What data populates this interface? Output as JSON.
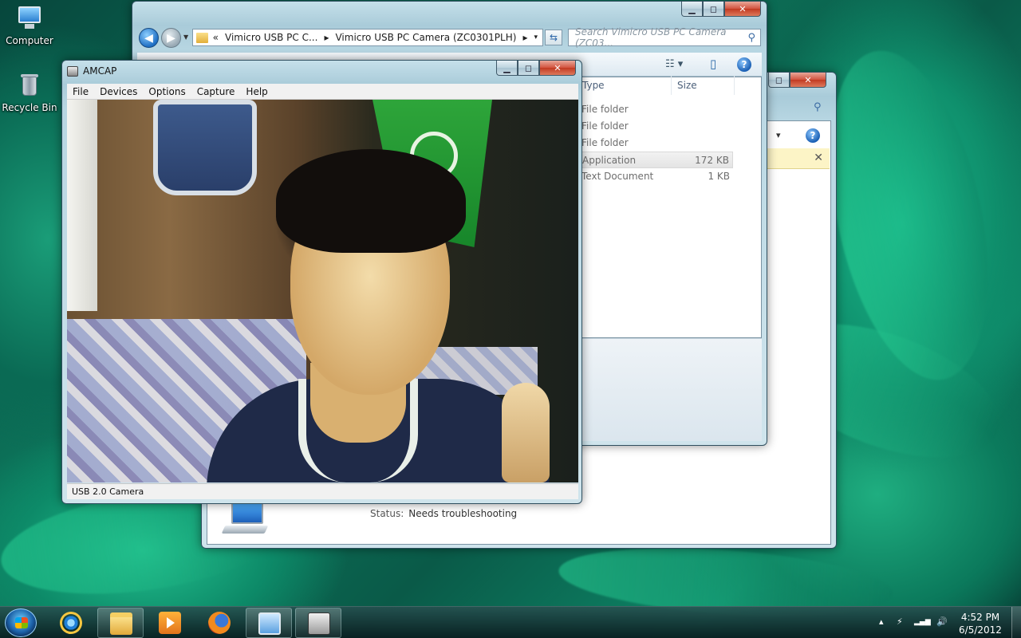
{
  "desktop": {
    "icons": [
      {
        "label": "Computer"
      },
      {
        "label": "Recycle Bin"
      }
    ]
  },
  "explorer_front": {
    "caption_buttons": {
      "minimize": "▁",
      "maximize": "◻",
      "close": "✕"
    },
    "nav": {
      "back": "◀",
      "forward": "▶",
      "history": "▼"
    },
    "address": {
      "prefix": "«",
      "crumbs": [
        "Vimicro USB PC C...",
        "Vimicro USB PC Camera (ZC0301PLH)"
      ],
      "separator": "▸",
      "caret": "▾"
    },
    "refresh_icon": "⇆",
    "search": {
      "placeholder": "Search Vimicro USB PC Camera (ZC03...",
      "icon": "⚲"
    },
    "toolbar": {
      "views_icon": "☷ ▾",
      "preview_icon": "▯",
      "help": "?"
    },
    "columns": {
      "type": "Type",
      "size": "Size"
    },
    "files": [
      {
        "type": "File folder",
        "size": ""
      },
      {
        "type": "File folder",
        "size": ""
      },
      {
        "type": "File folder",
        "size": ""
      },
      {
        "type": "Application",
        "size": "172 KB"
      },
      {
        "type": "Text Document",
        "size": "1 KB"
      }
    ]
  },
  "explorer_back": {
    "caption_buttons": {
      "maximize": "◻",
      "close": "✕"
    },
    "search_icon": "⚲",
    "views_caret": "▾",
    "help": "?",
    "info_close": "✕",
    "status": {
      "key": "Status:",
      "value": "Needs troubleshooting"
    }
  },
  "amcap": {
    "title": "AMCAP",
    "caption_buttons": {
      "minimize": "▁",
      "maximize": "◻",
      "close": "✕"
    },
    "menu": [
      "File",
      "Devices",
      "Options",
      "Capture",
      "Help"
    ],
    "status": "USB 2.0 Camera"
  },
  "taskbar": {
    "tray_icons": {
      "show_hidden": "▴",
      "power": "⚡",
      "network": "▂▄▆",
      "volume": "🔊"
    },
    "clock": {
      "time": "4:52 PM",
      "date": "6/5/2012"
    }
  }
}
